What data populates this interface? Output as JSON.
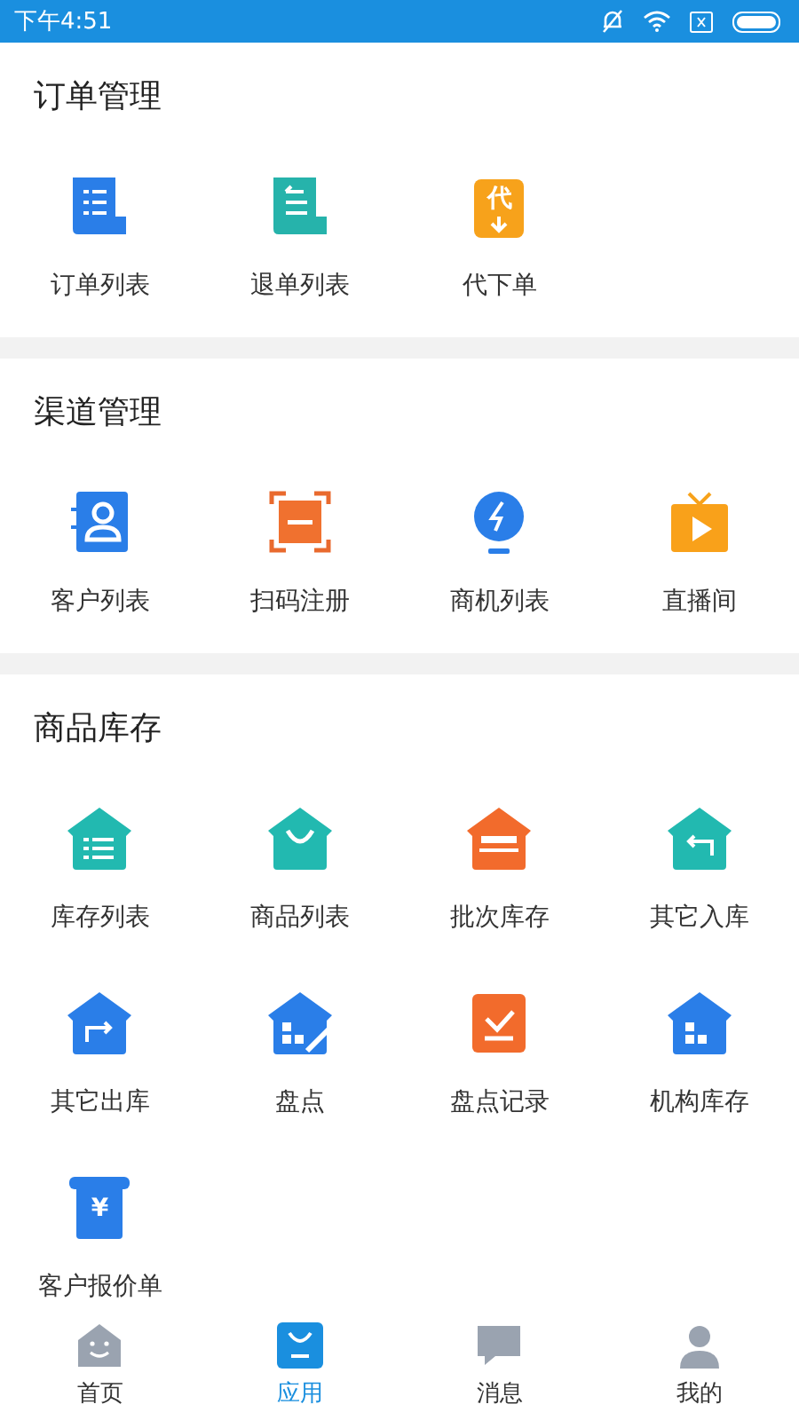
{
  "status_bar": {
    "time": "下午4:51"
  },
  "sections": [
    {
      "title": "订单管理",
      "items": [
        {
          "label": "订单列表",
          "kind": "doc-list"
        },
        {
          "label": "退单列表",
          "kind": "doc-return"
        },
        {
          "label": "代下单",
          "kind": "tag-down",
          "icon_text": "代"
        }
      ]
    },
    {
      "title": "渠道管理",
      "items": [
        {
          "label": "客户列表",
          "kind": "contact"
        },
        {
          "label": "扫码注册",
          "kind": "scan"
        },
        {
          "label": "商机列表",
          "kind": "bulb"
        },
        {
          "label": "直播间",
          "kind": "tv"
        }
      ]
    },
    {
      "title": "商品库存",
      "items": [
        {
          "label": "库存列表",
          "kind": "house-list"
        },
        {
          "label": "商品列表",
          "kind": "house-bag"
        },
        {
          "label": "批次库存",
          "kind": "house-barcode"
        },
        {
          "label": "其它入库",
          "kind": "house-in"
        },
        {
          "label": "其它出库",
          "kind": "house-out"
        },
        {
          "label": "盘点",
          "kind": "house-pen"
        },
        {
          "label": "盘点记录",
          "kind": "clip-check"
        },
        {
          "label": "机构库存",
          "kind": "house-grid"
        },
        {
          "label": "客户报价单",
          "kind": "ticket",
          "icon_text": "¥"
        }
      ]
    }
  ],
  "bottom_nav": [
    {
      "label": "首页",
      "kind": "home",
      "selected": false
    },
    {
      "label": "应用",
      "kind": "apps",
      "selected": true
    },
    {
      "label": "消息",
      "kind": "message",
      "selected": false
    },
    {
      "label": "我的",
      "kind": "profile",
      "selected": false
    }
  ]
}
